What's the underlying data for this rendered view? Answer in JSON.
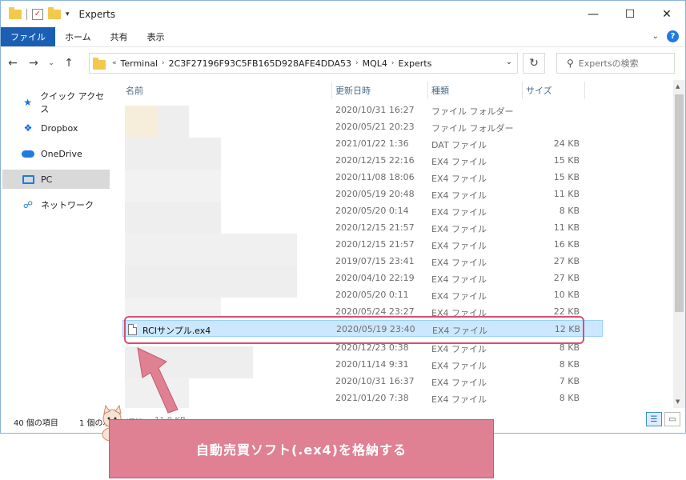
{
  "window": {
    "title": "Experts",
    "controls": {
      "minimize": "—",
      "maximize": "☐",
      "close": "✕"
    }
  },
  "ribbon": {
    "tabs": [
      "ファイル",
      "ホーム",
      "共有",
      "表示"
    ]
  },
  "nav": {
    "breadcrumb": [
      "«",
      "Terminal",
      "2C3F27196F93C5FB165D928AFE4DDA53",
      "MQL4",
      "Experts"
    ],
    "search_placeholder": "Expertsの検索"
  },
  "sidebar": {
    "items": [
      {
        "label": "クイック アクセス",
        "icon": "star-icon"
      },
      {
        "label": "Dropbox",
        "icon": "dropbox-icon"
      },
      {
        "label": "OneDrive",
        "icon": "cloud-icon"
      },
      {
        "label": "PC",
        "icon": "pc-icon",
        "active": true
      },
      {
        "label": "ネットワーク",
        "icon": "network-icon"
      }
    ]
  },
  "columns": {
    "name": "名前",
    "date": "更新日時",
    "type": "種類",
    "size": "サイズ"
  },
  "rows": [
    {
      "date": "2020/10/31 16:27",
      "type": "ファイル フォルダー",
      "size": ""
    },
    {
      "date": "2020/05/21 20:23",
      "type": "ファイル フォルダー",
      "size": ""
    },
    {
      "date": "2021/01/22 1:36",
      "type": "DAT ファイル",
      "size": "24 KB"
    },
    {
      "date": "2020/12/15 22:16",
      "type": "EX4 ファイル",
      "size": "15 KB"
    },
    {
      "date": "2020/11/08 18:06",
      "type": "EX4 ファイル",
      "size": "15 KB"
    },
    {
      "date": "2020/05/19 20:48",
      "type": "EX4 ファイル",
      "size": "11 KB"
    },
    {
      "date": "2020/05/20 0:14",
      "type": "EX4 ファイル",
      "size": "8 KB"
    },
    {
      "date": "2020/12/15 21:57",
      "type": "EX4 ファイル",
      "size": "11 KB"
    },
    {
      "date": "2020/12/15 21:57",
      "type": "EX4 ファイル",
      "size": "16 KB"
    },
    {
      "date": "2019/07/15 23:41",
      "type": "EX4 ファイル",
      "size": "27 KB"
    },
    {
      "date": "2020/04/10 22:19",
      "type": "EX4 ファイル",
      "size": "27 KB"
    },
    {
      "date": "2020/05/20 0:11",
      "type": "EX4 ファイル",
      "size": "10 KB"
    },
    {
      "date": "2020/05/24 23:27",
      "type": "EX4 ファイル",
      "size": "22 KB"
    }
  ],
  "selected_row": {
    "name": "RCIサンプル.ex4",
    "date": "2020/05/19 23:40",
    "type": "EX4 ファイル",
    "size": "12 KB"
  },
  "rows_after": [
    {
      "date": "2020/12/23 0:38",
      "type": "EX4 ファイル",
      "size": "8 KB"
    },
    {
      "date": "2020/11/14 9:31",
      "type": "EX4 ファイル",
      "size": "8 KB"
    },
    {
      "date": "2020/10/31 16:37",
      "type": "EX4 ファイル",
      "size": "7 KB"
    },
    {
      "date": "2021/01/20 7:38",
      "type": "EX4 ファイル",
      "size": "8 KB"
    }
  ],
  "status": {
    "item_count": "40 個の項目",
    "selection": "1 個の項目を選択",
    "selection_size": "11.9 KB"
  },
  "annotation": {
    "text": "自動売買ソフト(.ex4)を格納する",
    "color": "#df8093"
  }
}
